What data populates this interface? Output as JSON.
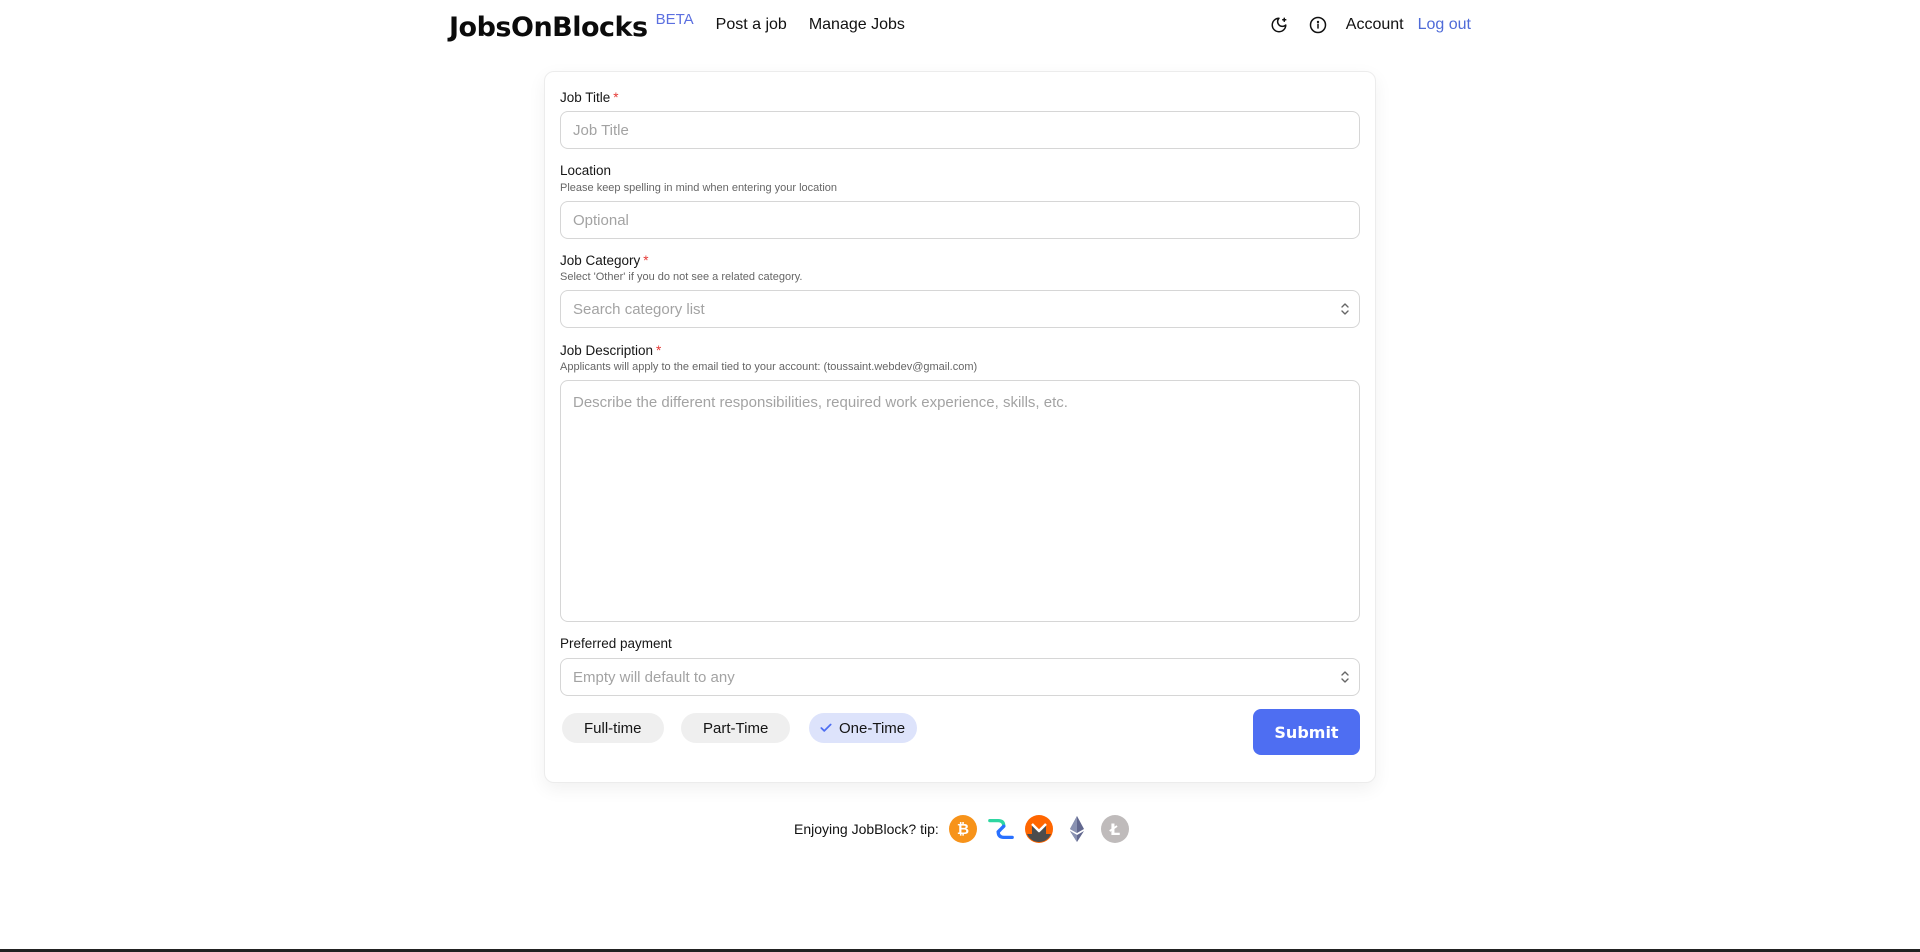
{
  "header": {
    "brand": "JobsOnBlocks",
    "beta": "BETA",
    "nav": [
      "Post a job",
      "Manage Jobs"
    ],
    "account": "Account",
    "logout": "Log out"
  },
  "form": {
    "job_title": {
      "label": "Job Title",
      "required": "*",
      "placeholder": "Job Title"
    },
    "location": {
      "label": "Location",
      "hint": "Please keep spelling in mind when entering your location",
      "placeholder": "Optional"
    },
    "category": {
      "label": "Job Category",
      "required": "*",
      "hint": "Select 'Other' if you do not see a related category.",
      "placeholder": "Search category list"
    },
    "description": {
      "label": "Job Description",
      "required": "*",
      "hint": "Applicants will apply to the email tied to your account: (toussaint.webdev@gmail.com)",
      "placeholder": "Describe the different responsibilities, required work experience, skills, etc."
    },
    "payment": {
      "label": "Preferred payment",
      "placeholder": "Empty will default to any"
    },
    "job_types": [
      "Full-time",
      "Part-Time",
      "One-Time"
    ],
    "selected_job_type": "One-Time",
    "submit": "Submit"
  },
  "tip": {
    "text": "Enjoying JobBlock? tip:",
    "coins": [
      "bitcoin-icon",
      "decred-icon",
      "monero-icon",
      "ethereum-icon",
      "litecoin-icon"
    ]
  },
  "colors": {
    "accent": "#4e6ef2",
    "required": "#e53935",
    "link": "#4f6bd8"
  }
}
